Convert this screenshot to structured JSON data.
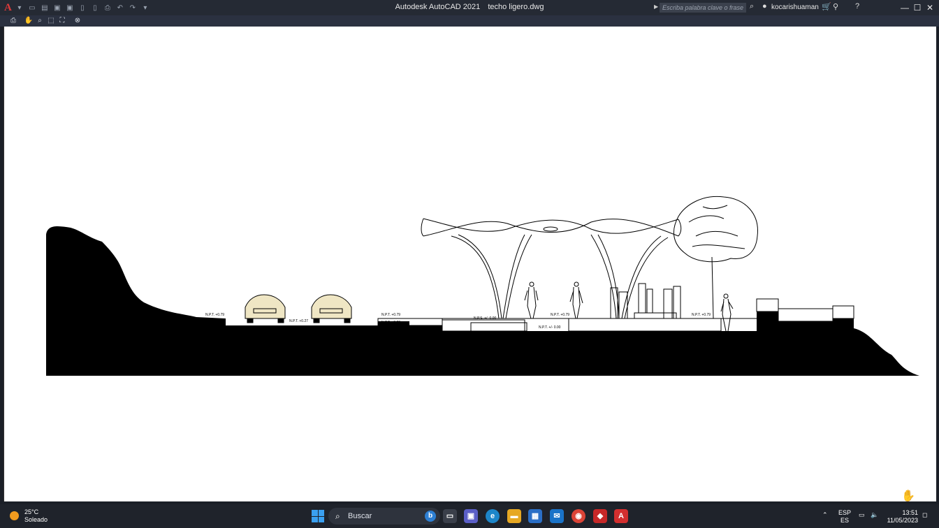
{
  "window": {
    "app_name": "Autodesk AutoCAD 2021",
    "file_name": "techo ligero.dwg",
    "search_placeholder": "Escriba palabra clave o frase",
    "user_name": "kocarishuaman"
  },
  "taskbar": {
    "weather_temp": "25°C",
    "weather_desc": "Soleado",
    "search_label": "Buscar",
    "lang_top": "ESP",
    "lang_bottom": "ES",
    "time": "13:51",
    "date": "11/05/2023"
  },
  "drawing": {
    "level_labels": [
      "N.P.T. +0.79",
      "N.P.T. +0.27",
      "N.P.T. +0.79",
      "N.P.T. +0.20",
      "N.P.S. +/- 0.00",
      "N.P.T. +0.79",
      "N.P.T. +/- 0.00",
      "N.P.T. +0.79"
    ]
  },
  "icons": {
    "logo": "autocad-logo-icon",
    "colors": {
      "title_bar": "#252a34",
      "toolbar": "#2b3140",
      "taskbar": "#1f232b",
      "accent_red": "#e03a3a"
    }
  }
}
